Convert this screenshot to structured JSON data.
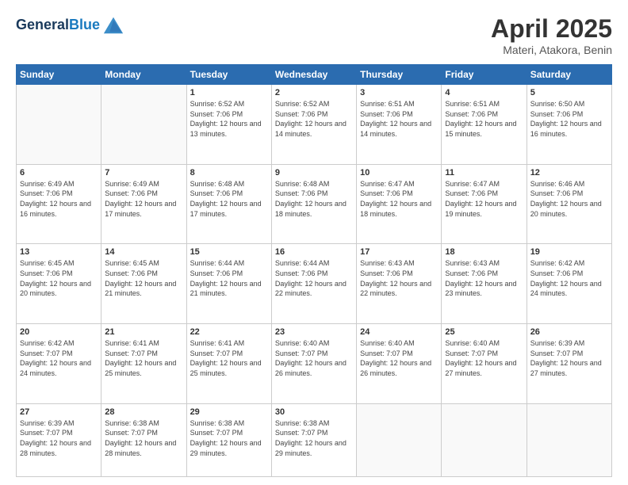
{
  "header": {
    "logo_line1": "General",
    "logo_line2": "Blue",
    "month": "April 2025",
    "location": "Materi, Atakora, Benin"
  },
  "weekdays": [
    "Sunday",
    "Monday",
    "Tuesday",
    "Wednesday",
    "Thursday",
    "Friday",
    "Saturday"
  ],
  "weeks": [
    [
      {
        "day": "",
        "sunrise": "",
        "sunset": "",
        "daylight": ""
      },
      {
        "day": "",
        "sunrise": "",
        "sunset": "",
        "daylight": ""
      },
      {
        "day": "1",
        "sunrise": "Sunrise: 6:52 AM",
        "sunset": "Sunset: 7:06 PM",
        "daylight": "Daylight: 12 hours and 13 minutes."
      },
      {
        "day": "2",
        "sunrise": "Sunrise: 6:52 AM",
        "sunset": "Sunset: 7:06 PM",
        "daylight": "Daylight: 12 hours and 14 minutes."
      },
      {
        "day": "3",
        "sunrise": "Sunrise: 6:51 AM",
        "sunset": "Sunset: 7:06 PM",
        "daylight": "Daylight: 12 hours and 14 minutes."
      },
      {
        "day": "4",
        "sunrise": "Sunrise: 6:51 AM",
        "sunset": "Sunset: 7:06 PM",
        "daylight": "Daylight: 12 hours and 15 minutes."
      },
      {
        "day": "5",
        "sunrise": "Sunrise: 6:50 AM",
        "sunset": "Sunset: 7:06 PM",
        "daylight": "Daylight: 12 hours and 16 minutes."
      }
    ],
    [
      {
        "day": "6",
        "sunrise": "Sunrise: 6:49 AM",
        "sunset": "Sunset: 7:06 PM",
        "daylight": "Daylight: 12 hours and 16 minutes."
      },
      {
        "day": "7",
        "sunrise": "Sunrise: 6:49 AM",
        "sunset": "Sunset: 7:06 PM",
        "daylight": "Daylight: 12 hours and 17 minutes."
      },
      {
        "day": "8",
        "sunrise": "Sunrise: 6:48 AM",
        "sunset": "Sunset: 7:06 PM",
        "daylight": "Daylight: 12 hours and 17 minutes."
      },
      {
        "day": "9",
        "sunrise": "Sunrise: 6:48 AM",
        "sunset": "Sunset: 7:06 PM",
        "daylight": "Daylight: 12 hours and 18 minutes."
      },
      {
        "day": "10",
        "sunrise": "Sunrise: 6:47 AM",
        "sunset": "Sunset: 7:06 PM",
        "daylight": "Daylight: 12 hours and 18 minutes."
      },
      {
        "day": "11",
        "sunrise": "Sunrise: 6:47 AM",
        "sunset": "Sunset: 7:06 PM",
        "daylight": "Daylight: 12 hours and 19 minutes."
      },
      {
        "day": "12",
        "sunrise": "Sunrise: 6:46 AM",
        "sunset": "Sunset: 7:06 PM",
        "daylight": "Daylight: 12 hours and 20 minutes."
      }
    ],
    [
      {
        "day": "13",
        "sunrise": "Sunrise: 6:45 AM",
        "sunset": "Sunset: 7:06 PM",
        "daylight": "Daylight: 12 hours and 20 minutes."
      },
      {
        "day": "14",
        "sunrise": "Sunrise: 6:45 AM",
        "sunset": "Sunset: 7:06 PM",
        "daylight": "Daylight: 12 hours and 21 minutes."
      },
      {
        "day": "15",
        "sunrise": "Sunrise: 6:44 AM",
        "sunset": "Sunset: 7:06 PM",
        "daylight": "Daylight: 12 hours and 21 minutes."
      },
      {
        "day": "16",
        "sunrise": "Sunrise: 6:44 AM",
        "sunset": "Sunset: 7:06 PM",
        "daylight": "Daylight: 12 hours and 22 minutes."
      },
      {
        "day": "17",
        "sunrise": "Sunrise: 6:43 AM",
        "sunset": "Sunset: 7:06 PM",
        "daylight": "Daylight: 12 hours and 22 minutes."
      },
      {
        "day": "18",
        "sunrise": "Sunrise: 6:43 AM",
        "sunset": "Sunset: 7:06 PM",
        "daylight": "Daylight: 12 hours and 23 minutes."
      },
      {
        "day": "19",
        "sunrise": "Sunrise: 6:42 AM",
        "sunset": "Sunset: 7:06 PM",
        "daylight": "Daylight: 12 hours and 24 minutes."
      }
    ],
    [
      {
        "day": "20",
        "sunrise": "Sunrise: 6:42 AM",
        "sunset": "Sunset: 7:07 PM",
        "daylight": "Daylight: 12 hours and 24 minutes."
      },
      {
        "day": "21",
        "sunrise": "Sunrise: 6:41 AM",
        "sunset": "Sunset: 7:07 PM",
        "daylight": "Daylight: 12 hours and 25 minutes."
      },
      {
        "day": "22",
        "sunrise": "Sunrise: 6:41 AM",
        "sunset": "Sunset: 7:07 PM",
        "daylight": "Daylight: 12 hours and 25 minutes."
      },
      {
        "day": "23",
        "sunrise": "Sunrise: 6:40 AM",
        "sunset": "Sunset: 7:07 PM",
        "daylight": "Daylight: 12 hours and 26 minutes."
      },
      {
        "day": "24",
        "sunrise": "Sunrise: 6:40 AM",
        "sunset": "Sunset: 7:07 PM",
        "daylight": "Daylight: 12 hours and 26 minutes."
      },
      {
        "day": "25",
        "sunrise": "Sunrise: 6:40 AM",
        "sunset": "Sunset: 7:07 PM",
        "daylight": "Daylight: 12 hours and 27 minutes."
      },
      {
        "day": "26",
        "sunrise": "Sunrise: 6:39 AM",
        "sunset": "Sunset: 7:07 PM",
        "daylight": "Daylight: 12 hours and 27 minutes."
      }
    ],
    [
      {
        "day": "27",
        "sunrise": "Sunrise: 6:39 AM",
        "sunset": "Sunset: 7:07 PM",
        "daylight": "Daylight: 12 hours and 28 minutes."
      },
      {
        "day": "28",
        "sunrise": "Sunrise: 6:38 AM",
        "sunset": "Sunset: 7:07 PM",
        "daylight": "Daylight: 12 hours and 28 minutes."
      },
      {
        "day": "29",
        "sunrise": "Sunrise: 6:38 AM",
        "sunset": "Sunset: 7:07 PM",
        "daylight": "Daylight: 12 hours and 29 minutes."
      },
      {
        "day": "30",
        "sunrise": "Sunrise: 6:38 AM",
        "sunset": "Sunset: 7:07 PM",
        "daylight": "Daylight: 12 hours and 29 minutes."
      },
      {
        "day": "",
        "sunrise": "",
        "sunset": "",
        "daylight": ""
      },
      {
        "day": "",
        "sunrise": "",
        "sunset": "",
        "daylight": ""
      },
      {
        "day": "",
        "sunrise": "",
        "sunset": "",
        "daylight": ""
      }
    ]
  ]
}
